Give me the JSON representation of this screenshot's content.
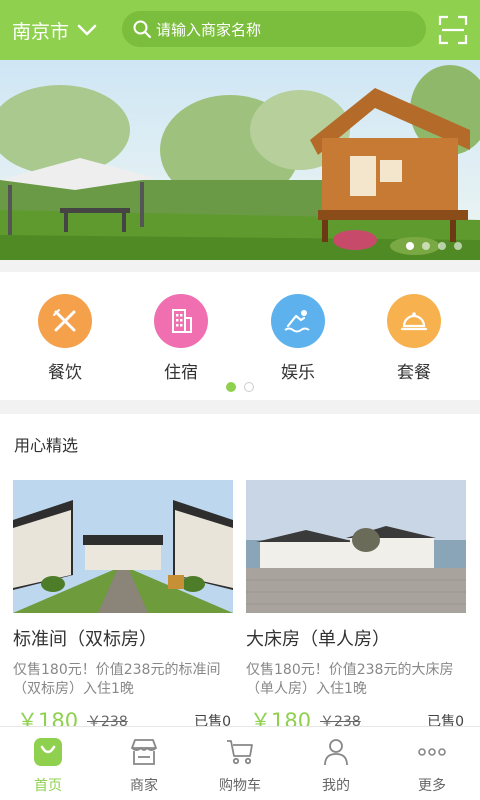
{
  "header": {
    "city": "南京市",
    "search_placeholder": "请输入商家名称",
    "brand_color": "#8fd14f"
  },
  "banner": {
    "slides": 4,
    "active_slide": 1
  },
  "categories": [
    {
      "label": "餐饮",
      "icon": "utensils-icon",
      "color": "#f5a04a"
    },
    {
      "label": "住宿",
      "icon": "building-icon",
      "color": "#ef6fb0"
    },
    {
      "label": "娱乐",
      "icon": "swimming-icon",
      "color": "#5db2ee"
    },
    {
      "label": "套餐",
      "icon": "cloche-icon",
      "color": "#f7b24f"
    }
  ],
  "category_pager": {
    "pages": 2,
    "active": 1
  },
  "picks": {
    "title": "用心精选",
    "items": [
      {
        "name": "标准间（双标房）",
        "desc": "仅售180元！价值238元的标准间（双标房）入住1晚",
        "price": "￥180",
        "old_price": "￥238",
        "sold": "已售0"
      },
      {
        "name": "大床房（单人房）",
        "desc": "仅售180元！价值238元的大床房（单人房）入住1晚",
        "price": "￥180",
        "old_price": "￥238",
        "sold": "已售0"
      }
    ]
  },
  "tabbar": {
    "active": "home",
    "tabs": [
      {
        "id": "home",
        "label": "首页",
        "icon": "bag-icon"
      },
      {
        "id": "merchants",
        "label": "商家",
        "icon": "store-icon"
      },
      {
        "id": "cart",
        "label": "购物车",
        "icon": "cart-icon"
      },
      {
        "id": "mine",
        "label": "我的",
        "icon": "person-icon"
      },
      {
        "id": "more",
        "label": "更多",
        "icon": "more-icon"
      }
    ]
  }
}
